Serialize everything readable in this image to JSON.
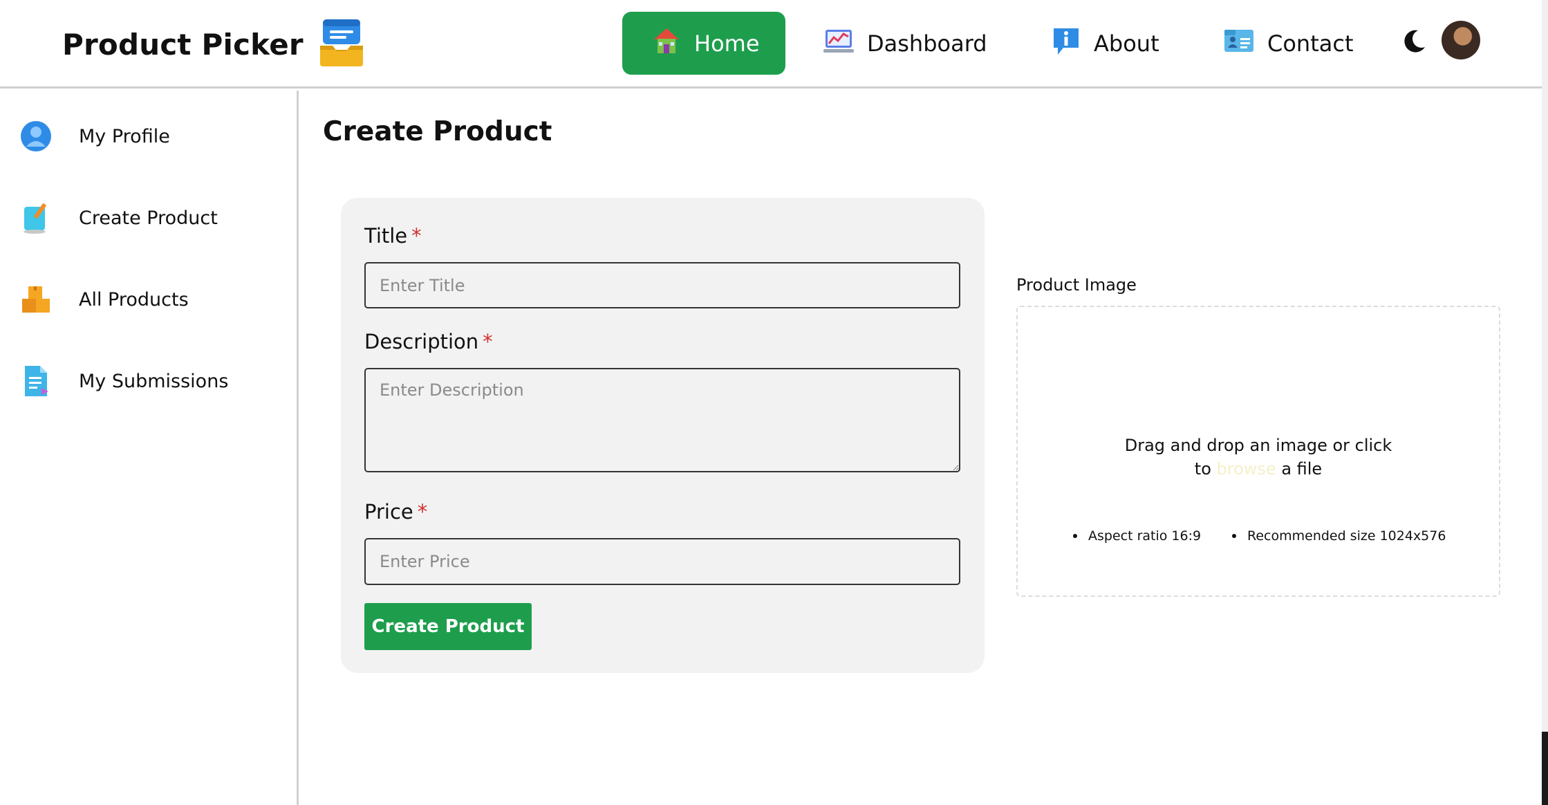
{
  "header": {
    "brand_title": "Product Picker",
    "brand_icon": "inbox-tray-icon",
    "nav": [
      {
        "label": "Home",
        "icon": "house-icon",
        "active": true
      },
      {
        "label": "Dashboard",
        "icon": "chart-laptop-icon",
        "active": false
      },
      {
        "label": "About",
        "icon": "info-bubble-icon",
        "active": false
      },
      {
        "label": "Contact",
        "icon": "contact-card-icon",
        "active": false
      }
    ],
    "theme_icon": "moon-icon",
    "avatar_icon": "user-avatar"
  },
  "sidebar": {
    "items": [
      {
        "label": "My Profile",
        "icon": "user-circle-icon"
      },
      {
        "label": "Create Product",
        "icon": "notepad-pencil-icon"
      },
      {
        "label": "All Products",
        "icon": "boxes-icon"
      },
      {
        "label": "My Submissions",
        "icon": "document-icon"
      }
    ]
  },
  "main": {
    "title": "Create Product",
    "form": {
      "title_label": "Title",
      "title_placeholder": "Enter Title",
      "title_value": "",
      "description_label": "Description",
      "description_placeholder": "Enter Description",
      "description_value": "",
      "price_label": "Price",
      "price_placeholder": "Enter Price",
      "price_value": "",
      "required_mark": "*",
      "submit_label": "Create Product"
    },
    "image_upload": {
      "label": "Product Image",
      "drop_text_before": "Drag and drop an image or click",
      "drop_text_to": "to",
      "drop_text_link": "browse",
      "drop_text_after": "a file",
      "hints": [
        "Aspect ratio 16:9",
        "Recommended size 1024x576"
      ]
    }
  },
  "colors": {
    "accent": "#1e9e4d",
    "required": "#d32f2f",
    "card_bg": "#f2f2f2"
  }
}
